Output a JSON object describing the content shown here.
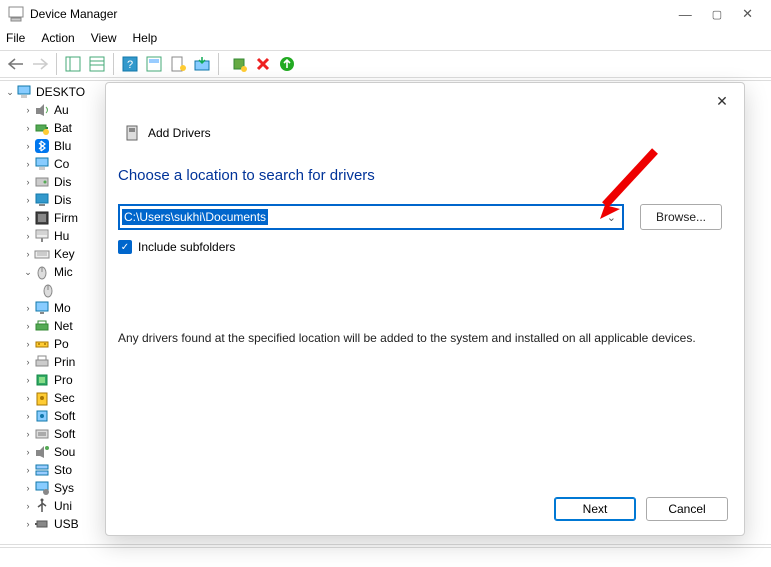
{
  "titlebar": {
    "title": "Device Manager"
  },
  "menubar": {
    "file": "File",
    "action": "Action",
    "view": "View",
    "help": "Help"
  },
  "tree": {
    "root": "DESKTO",
    "items": [
      {
        "label": "Au",
        "kind": "audio"
      },
      {
        "label": "Bat",
        "kind": "battery"
      },
      {
        "label": "Blu",
        "kind": "bluetooth"
      },
      {
        "label": "Co",
        "kind": "computer"
      },
      {
        "label": "Dis",
        "kind": "disk"
      },
      {
        "label": "Dis",
        "kind": "display"
      },
      {
        "label": "Firm",
        "kind": "firmware"
      },
      {
        "label": "Hu",
        "kind": "hid"
      },
      {
        "label": "Key",
        "kind": "keyboard"
      },
      {
        "label": "Mic",
        "kind": "mouse",
        "expanded": true
      },
      {
        "label": "Mo",
        "kind": "monitor"
      },
      {
        "label": "Net",
        "kind": "network"
      },
      {
        "label": "Po",
        "kind": "port"
      },
      {
        "label": "Prin",
        "kind": "printq"
      },
      {
        "label": "Pro",
        "kind": "processor"
      },
      {
        "label": "Sec",
        "kind": "security"
      },
      {
        "label": "Soft",
        "kind": "softcomp"
      },
      {
        "label": "Soft",
        "kind": "softdev"
      },
      {
        "label": "Sou",
        "kind": "sound"
      },
      {
        "label": "Sto",
        "kind": "storage"
      },
      {
        "label": "Sys",
        "kind": "system"
      },
      {
        "label": "Uni",
        "kind": "usb"
      },
      {
        "label": "USB",
        "kind": "usbconn"
      }
    ]
  },
  "dialog": {
    "title": "Add Drivers",
    "heading": "Choose a location to search for drivers",
    "path": "C:\\Users\\sukhi\\Documents",
    "browse": "Browse...",
    "include_subfolders": "Include subfolders",
    "description": "Any drivers found at the specified location will be added to the system and installed on all applicable devices.",
    "next": "Next",
    "cancel": "Cancel"
  },
  "icons": {
    "back": "back-icon",
    "forward": "forward-icon",
    "properties": "properties-icon",
    "options": "options-icon",
    "help": "help-icon",
    "show-hidden": "show-hidden-icon",
    "scan": "scan-icon",
    "update": "update-icon",
    "add-driver": "add-driver-icon",
    "remove": "remove-icon",
    "install": "install-icon"
  }
}
